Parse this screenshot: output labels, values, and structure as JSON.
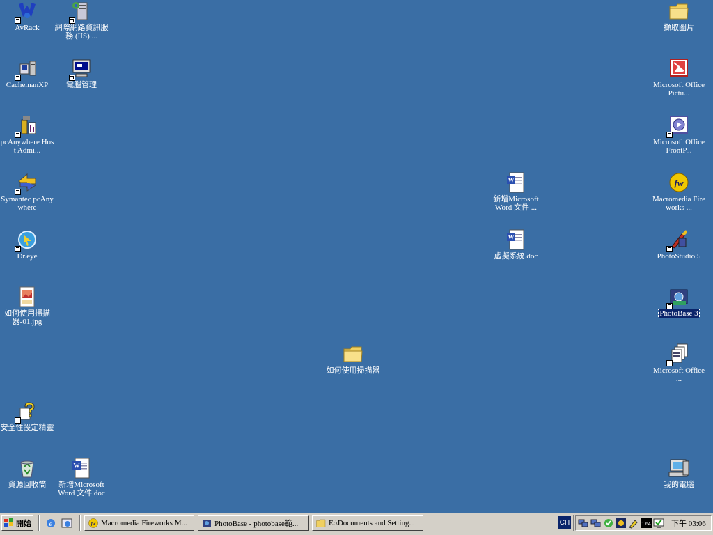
{
  "desktop": {
    "icons": [
      {
        "id": "avrack",
        "label": "AvRack",
        "shortcut": true,
        "icon": "avrack-icon"
      },
      {
        "id": "iis",
        "label": "網際網路資訊服務 (IIS) ...",
        "shortcut": true,
        "icon": "iis-server-icon"
      },
      {
        "id": "cachemanxp",
        "label": "CachemanXP",
        "shortcut": true,
        "icon": "cacheman-icon"
      },
      {
        "id": "computer-management",
        "label": "電腦管理",
        "shortcut": true,
        "icon": "computer-management-icon"
      },
      {
        "id": "pcanywhere-host",
        "label": "pcAnywhere Host Admi...",
        "shortcut": true,
        "icon": "pcanywhere-host-icon"
      },
      {
        "id": "symantec-pcanywhere",
        "label": "Symantec pcAnywhere",
        "shortcut": true,
        "icon": "pcanywhere-icon"
      },
      {
        "id": "dreye",
        "label": "Dr.eye",
        "shortcut": true,
        "icon": "dreye-icon"
      },
      {
        "id": "scanner-jpg",
        "label": "如何使用掃描器-01.jpg",
        "shortcut": false,
        "icon": "image-file-icon"
      },
      {
        "id": "security-template",
        "label": "安全性設定精靈",
        "shortcut": true,
        "icon": "security-wizard-icon"
      },
      {
        "id": "recycle-bin",
        "label": "資源回收筒",
        "shortcut": false,
        "icon": "recycle-bin-icon"
      },
      {
        "id": "new-word-doc",
        "label": "新增Microsoft Word 文件.doc",
        "shortcut": false,
        "icon": "word-doc-icon"
      },
      {
        "id": "scanner-folder",
        "label": "如何使用掃描器",
        "shortcut": false,
        "icon": "folder-icon"
      },
      {
        "id": "new-word-doc-2",
        "label": "新增Microsoft Word 文件 ...",
        "shortcut": false,
        "icon": "word-doc-icon"
      },
      {
        "id": "virtual-system-doc",
        "label": "虛擬系統.doc",
        "shortcut": false,
        "icon": "word-doc-icon"
      },
      {
        "id": "capture-pictures",
        "label": "擷取圖片",
        "shortcut": false,
        "icon": "folder-icon"
      },
      {
        "id": "office-picture",
        "label": "Microsoft Office Pictu...",
        "shortcut": false,
        "icon": "office-picture-icon"
      },
      {
        "id": "office-frontpage",
        "label": "Microsoft Office FrontP...",
        "shortcut": false,
        "icon": "frontpage-icon"
      },
      {
        "id": "fireworks",
        "label": "Macromedia Fireworks ...",
        "shortcut": false,
        "icon": "fireworks-icon"
      },
      {
        "id": "photostudio",
        "label": "PhotoStudio 5",
        "shortcut": true,
        "icon": "photostudio-icon"
      },
      {
        "id": "photobase",
        "label": "PhotoBase 3",
        "shortcut": true,
        "icon": "photobase-icon",
        "selected": true
      },
      {
        "id": "office-tools",
        "label": "Microsoft Office ...",
        "shortcut": true,
        "icon": "office-tools-icon"
      },
      {
        "id": "my-computer",
        "label": "我的電腦",
        "shortcut": false,
        "icon": "my-computer-icon"
      }
    ]
  },
  "taskbar": {
    "start_label": "開始",
    "quick_launch": [
      {
        "name": "internet-explorer-icon"
      },
      {
        "name": "ie-quick-icon"
      }
    ],
    "tasks": [
      {
        "label": "Macromedia Fireworks M...",
        "icon": "fireworks-icon"
      },
      {
        "label": "PhotoBase - photobase範...",
        "icon": "photobase-icon"
      },
      {
        "label": "E:\\Documents and Setting...",
        "icon": "folder-icon"
      }
    ],
    "lang": "CH",
    "tray_badge": "1.64",
    "clock": "下午 03:06"
  },
  "colors": {
    "desktop": "#3a6ea5",
    "taskbar": "#d4d0c8",
    "selection": "#0a246a"
  }
}
